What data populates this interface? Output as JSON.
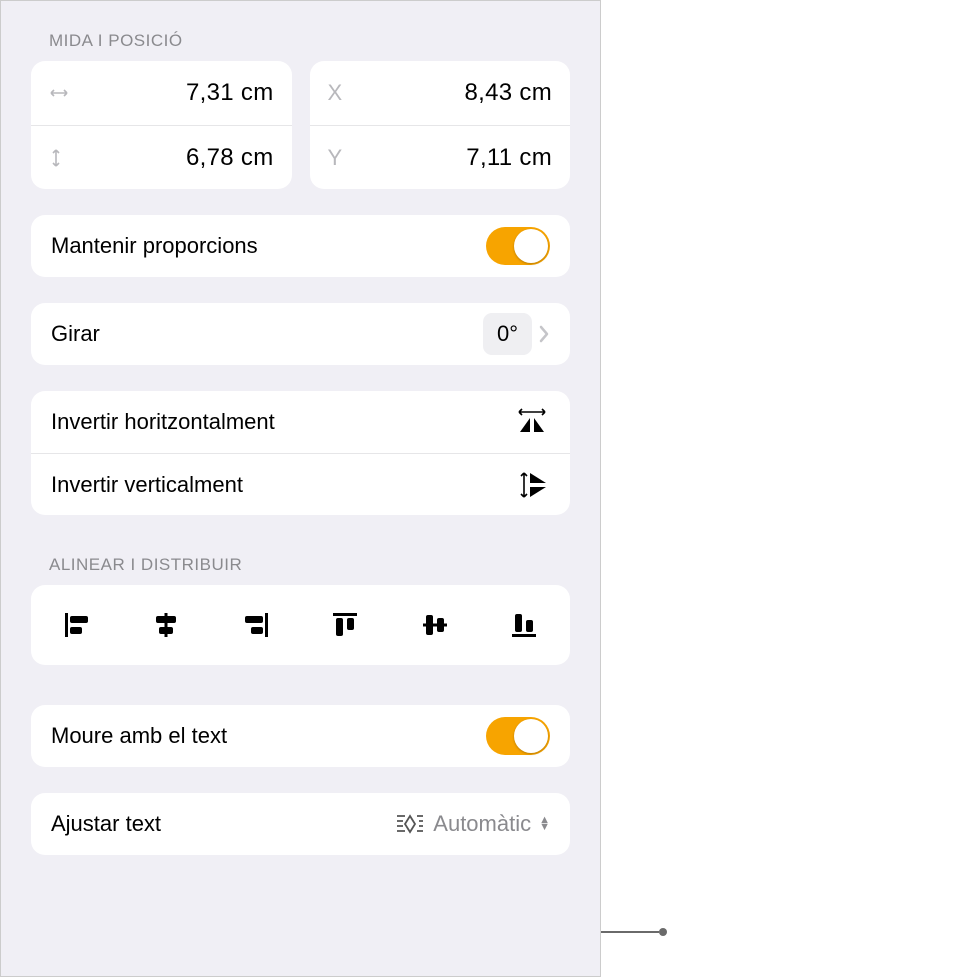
{
  "sections": {
    "size_position_header": "MIDA I POSICIÓ",
    "align_header": "ALINEAR I DISTRIBUIR"
  },
  "size": {
    "width": "7,31 cm",
    "height": "6,78 cm",
    "x": "8,43 cm",
    "y": "7,11 cm",
    "x_label": "X",
    "y_label": "Y"
  },
  "constrain": {
    "label": "Mantenir proporcions",
    "on": true
  },
  "rotate": {
    "label": "Girar",
    "value": "0°"
  },
  "flip": {
    "horizontal": "Invertir horitzontalment",
    "vertical": "Invertir verticalment"
  },
  "move_with_text": {
    "label": "Moure amb el text",
    "on": true
  },
  "wrap": {
    "label": "Ajustar text",
    "value": "Automàtic"
  }
}
